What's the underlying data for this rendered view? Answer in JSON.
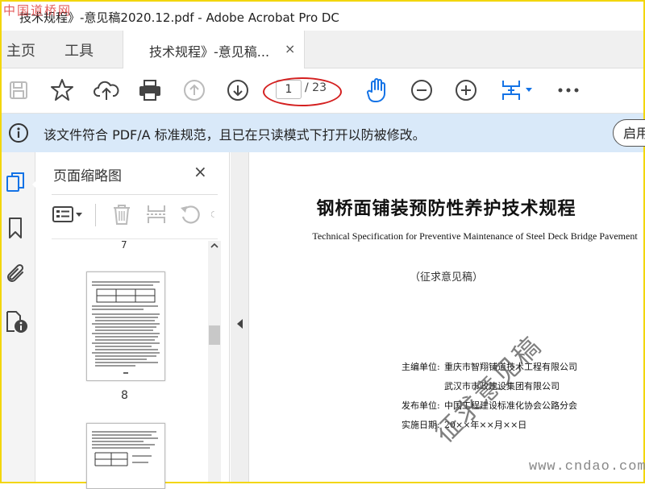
{
  "window": {
    "title": "技术规程》-意见稿2020.12.pdf - Adobe Acrobat Pro DC",
    "watermark_top": "中国道桥网"
  },
  "nav": {
    "home": "主页",
    "tools": "工具"
  },
  "tab": {
    "label": "技术规程》-意见稿...",
    "close": "×"
  },
  "toolbar": {
    "current_page": "1",
    "total_pages": "/ 23"
  },
  "infobar": {
    "message": "该文件符合 PDF/A 标准规范，且已在只读模式下打开以防被修改。",
    "button": "启用"
  },
  "thumbnails": {
    "title": "页面缩略图",
    "close": "×",
    "page_top_label": "7",
    "page_label": "8"
  },
  "document": {
    "title": "钢桥面铺装预防性养护技术规程",
    "subtitle": "Technical Specification for Preventive Maintenance of Steel Deck Bridge Pavement",
    "draft": "（征求意见稿）",
    "editor_label": "主编单位:",
    "editor_1": "重庆市智翔铺道技术工程有限公司",
    "editor_2": "武汉市市政建设集团有限公司",
    "publisher_label": "发布单位:",
    "publisher": "中国工程建设标准化协会公路分会",
    "date_label": "实施日期:",
    "date": "20××年××月××日",
    "stamp": "征求意见稿"
  },
  "watermark_bottom": "www.cndao.com",
  "colors": {
    "accent": "#1473e6",
    "infobar": "#d9e9f9",
    "annotation": "#d42020",
    "frame": "#f3d60c"
  }
}
